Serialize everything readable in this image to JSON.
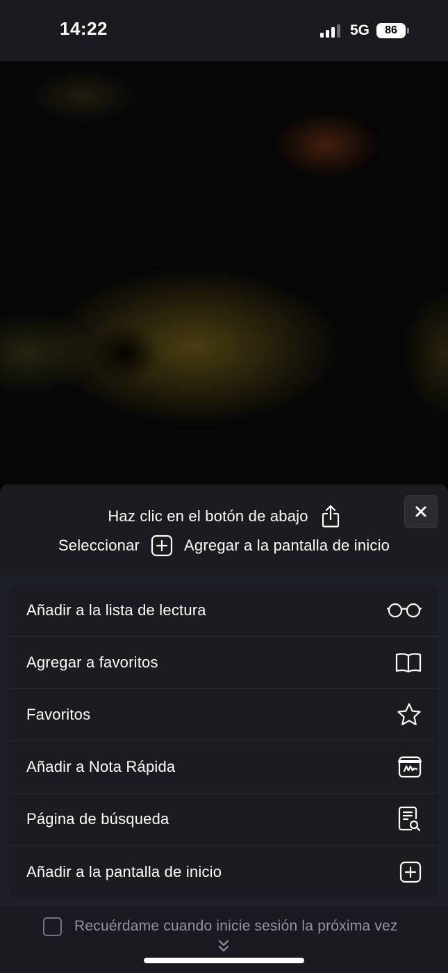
{
  "status_bar": {
    "time": "14:22",
    "network": "5G",
    "battery": "86"
  },
  "sheet": {
    "instruction_line1": "Haz clic en el botón de abajo",
    "instruction_select": "Seleccionar",
    "instruction_add_home": "Agregar a la pantalla de inicio",
    "close_icon": "close-icon"
  },
  "menu": {
    "items": [
      {
        "label": "Añadir a la lista de lectura",
        "icon": "glasses-icon"
      },
      {
        "label": "Agregar a favoritos",
        "icon": "book-icon"
      },
      {
        "label": "Favoritos",
        "icon": "star-icon"
      },
      {
        "label": "Añadir a Nota Rápida",
        "icon": "quick-note-icon"
      },
      {
        "label": "Página de búsqueda",
        "icon": "page-search-icon"
      },
      {
        "label": "Añadir a la pantalla de inicio",
        "icon": "plus-square-icon"
      }
    ]
  },
  "remember": {
    "label": "Recuérdame cuando inicie sesión la próxima vez",
    "checked": false
  },
  "colors": {
    "sheet_bg": "#1c1b20",
    "menu_area_bg": "#1d2027",
    "muted_text": "#8e94a4",
    "text": "#ffffff"
  }
}
